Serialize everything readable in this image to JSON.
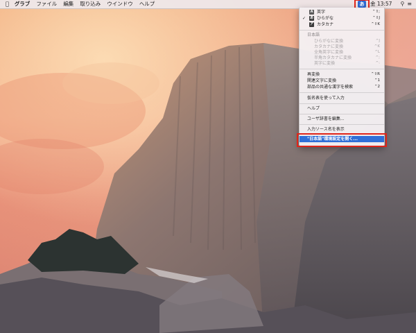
{
  "menubar": {
    "apple_icon": "apple-icon",
    "app_name": "グラブ",
    "items": [
      "ファイル",
      "編集",
      "取り込み",
      "ウインドウ",
      "ヘルプ"
    ],
    "ime_icon_label": "あ",
    "clock": "金 13:57",
    "status_icons": [
      "search-icon",
      "list-icon"
    ]
  },
  "ime_menu": {
    "inputs": [
      {
        "badge": "A",
        "label": "英字",
        "shortcut": "⌃⇧;",
        "checked": false
      },
      {
        "badge": "あ",
        "label": "ひらがな",
        "shortcut": "⌃⇧J",
        "checked": true
      },
      {
        "badge": "ア",
        "label": "カタカナ",
        "shortcut": "⌃⇧K",
        "checked": false
      }
    ],
    "conversion_header": "日本語",
    "conversions": [
      {
        "label": "ひらがなに変換",
        "shortcut": "^J"
      },
      {
        "label": "カタカナに変換",
        "shortcut": "^K"
      },
      {
        "label": "全角英字に変換",
        "shortcut": "^L"
      },
      {
        "label": "半角カタカナに変換",
        "shortcut": "^;"
      },
      {
        "label": "英字に変換",
        "shortcut": "^:"
      }
    ],
    "actions": [
      {
        "label": "再変換",
        "shortcut": "⌃⇧R"
      },
      {
        "label": "関連文字に変換",
        "shortcut": "⌃1"
      },
      {
        "label": "部品の共通な漢字を検索",
        "shortcut": "⌃2"
      }
    ],
    "kana_table": "仮名表を使って入力",
    "help": "ヘルプ",
    "user_dict": "ユーザ辞書を編集...",
    "show_source_name": "入力ソース名を表示",
    "open_prefs": "\"日本語\"環境設定を開く..."
  },
  "colors": {
    "accent": "#2f6fd8",
    "highlight_outline": "#e0251a"
  }
}
